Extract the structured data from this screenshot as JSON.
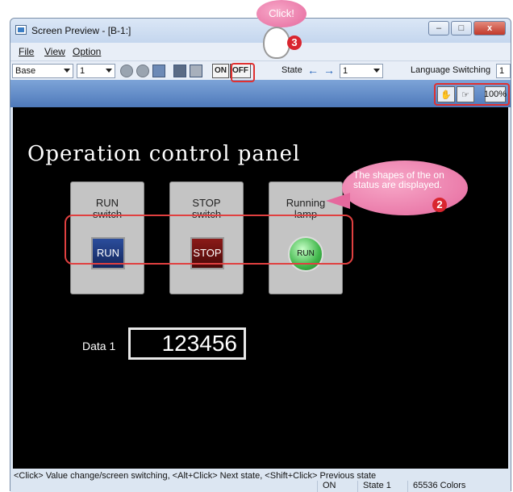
{
  "window": {
    "title": "Screen Preview - [B-1:]"
  },
  "winbtns": {
    "minimize": "–",
    "maximize": "□",
    "close": "x"
  },
  "menu": {
    "file": "File",
    "view": "View",
    "option": "Option"
  },
  "toolbar": {
    "screen_type": "Base",
    "screen_no": "1",
    "on_label": "ON",
    "off_label": "OFF",
    "state_label": "State",
    "state_value": "1",
    "lang_label": "Language Switching",
    "lang_value": "1",
    "left_arrow": "←",
    "right_arrow": "→"
  },
  "panel": {
    "title": "Operation control panel",
    "run_panel_label": "RUN\nswitch",
    "run_button": "RUN",
    "stop_panel_label": "STOP\nswitch",
    "stop_button": "STOP",
    "lamp_panel_label": "Running\nlamp",
    "lamp_text": "RUN",
    "data_label": "Data 1",
    "data_value": "123456"
  },
  "annotations": {
    "click_text": "Click!",
    "step3": "3",
    "step2": "2",
    "bubble2_text": "The shapes of the on status are displayed."
  },
  "zoom_icon_label": "100%",
  "status": {
    "hint": "<Click> Value change/screen switching, <Alt+Click> Next state, <Shift+Click> Previous state",
    "onoff": "ON",
    "state": "State 1",
    "colors": "65536 Colors"
  }
}
